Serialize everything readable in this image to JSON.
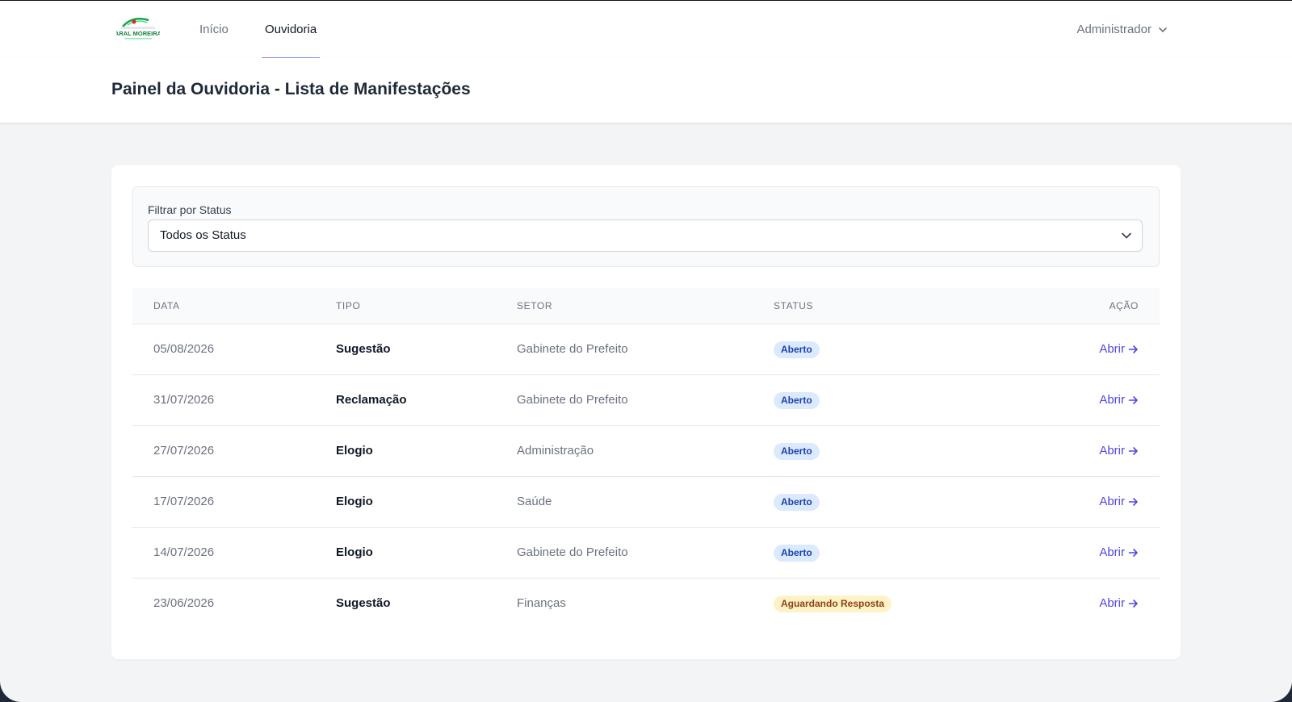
{
  "nav": {
    "logo_text": "ARAL MOREIRA",
    "links": [
      {
        "label": "Início",
        "active": false
      },
      {
        "label": "Ouvidoria",
        "active": true
      }
    ],
    "user_menu": "Administrador"
  },
  "header": {
    "title": "Painel da Ouvidoria - Lista de Manifestações"
  },
  "filter": {
    "label": "Filtrar por Status",
    "selected": "Todos os Status"
  },
  "table": {
    "columns": [
      "DATA",
      "TIPO",
      "SETOR",
      "STATUS",
      "AÇÃO"
    ],
    "rows": [
      {
        "data": "05/08/2026",
        "tipo": "Sugestão",
        "setor": "Gabinete do Prefeito",
        "status": "Aberto",
        "status_kind": "open",
        "acao": "Abrir"
      },
      {
        "data": "31/07/2026",
        "tipo": "Reclamação",
        "setor": "Gabinete do Prefeito",
        "status": "Aberto",
        "status_kind": "open",
        "acao": "Abrir"
      },
      {
        "data": "27/07/2026",
        "tipo": "Elogio",
        "setor": "Administração",
        "status": "Aberto",
        "status_kind": "open",
        "acao": "Abrir"
      },
      {
        "data": "17/07/2026",
        "tipo": "Elogio",
        "setor": "Saúde",
        "status": "Aberto",
        "status_kind": "open",
        "acao": "Abrir"
      },
      {
        "data": "14/07/2026",
        "tipo": "Elogio",
        "setor": "Gabinete do Prefeito",
        "status": "Aberto",
        "status_kind": "open",
        "acao": "Abrir"
      },
      {
        "data": "23/06/2026",
        "tipo": "Sugestão",
        "setor": "Finanças",
        "status": "Aguardando Resposta",
        "status_kind": "waiting",
        "acao": "Abrir"
      }
    ]
  },
  "colors": {
    "accent": "#4f46e5",
    "nav_underline": "#818cf8",
    "badge_open_bg": "#dbeafe",
    "badge_wait_bg": "#fef3c7"
  },
  "icons": {
    "logo": "municipal-logo-icon",
    "user_chevron": "chevron-down-icon",
    "select_chevron": "chevron-down-icon",
    "row_action": "arrow-right-icon"
  }
}
